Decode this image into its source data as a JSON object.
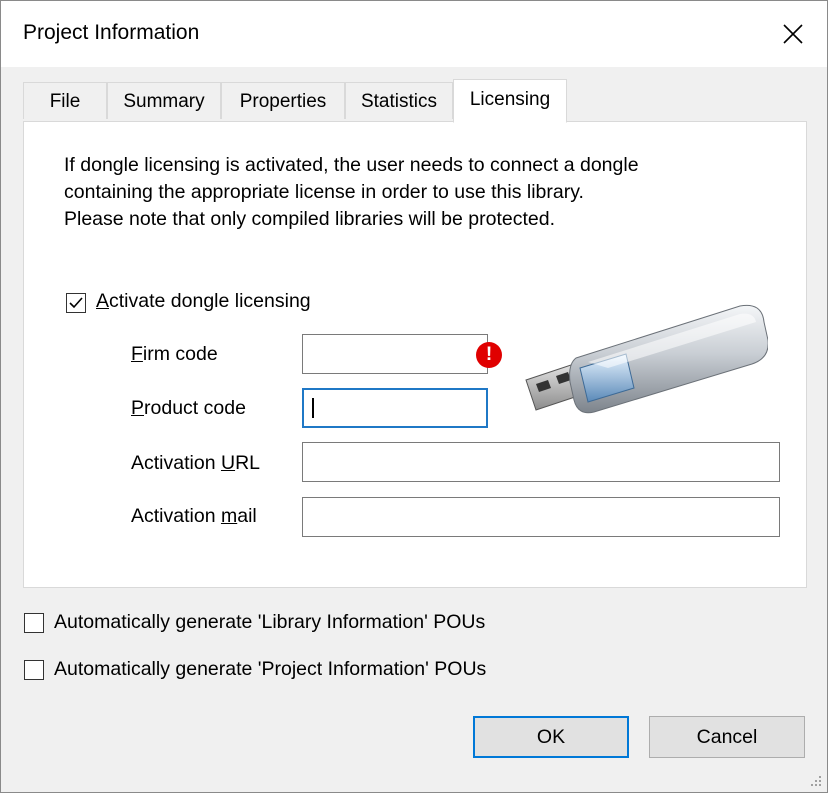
{
  "window": {
    "title": "Project Information"
  },
  "tabs": [
    {
      "label": "File",
      "active": false
    },
    {
      "label": "Summary",
      "active": false
    },
    {
      "label": "Properties",
      "active": false
    },
    {
      "label": "Statistics",
      "active": false
    },
    {
      "label": "Licensing",
      "active": true
    }
  ],
  "licensing": {
    "info_lines": [
      "If dongle licensing is activated, the user needs to connect a dongle",
      "containing the appropriate license in order to use this library.",
      "Please note that only compiled libraries will be protected."
    ],
    "activate_checkbox": {
      "label_mnemonic": "A",
      "label_rest": "ctivate dongle licensing",
      "checked": true
    },
    "firm_code": {
      "label_mnemonic": "F",
      "label_rest": "irm code",
      "value": "",
      "error_icon": "error-icon",
      "error_glyph": "!"
    },
    "product_code": {
      "label_mnemonic": "P",
      "label_rest": "roduct code",
      "value": ""
    },
    "activation_url": {
      "label_pre": "Activation ",
      "label_mnemonic": "U",
      "label_post": "RL",
      "value": ""
    },
    "activation_mail": {
      "label_pre": "Activation ",
      "label_mnemonic": "m",
      "label_post": "ail",
      "value": ""
    },
    "image": "usb-dongle-image"
  },
  "options": {
    "library_pous": {
      "label": "Automatically generate 'Library Information' POUs",
      "checked": false
    },
    "project_pous": {
      "label": "Automatically generate 'Project Information' POUs",
      "checked": false
    }
  },
  "buttons": {
    "ok": "OK",
    "cancel": "Cancel"
  },
  "colors": {
    "accent": "#0078d7",
    "error": "#e00000",
    "focus": "#1f78c6"
  }
}
